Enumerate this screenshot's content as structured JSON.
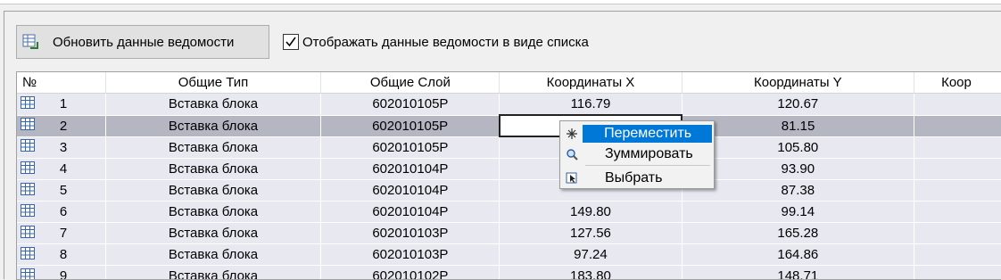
{
  "toolbar": {
    "update_label": "Обновить данные ведомости",
    "list_view_label": "Отображать данные ведомости в виде списка",
    "list_view_checked": true
  },
  "table": {
    "columns": [
      "№",
      "Общие Тип",
      "Общие Слой",
      "Координаты X",
      "Координаты Y",
      "Коор"
    ],
    "rows": [
      {
        "n": "1",
        "type": "Вставка блока",
        "layer": "602010105P",
        "x": "116.79",
        "y": "120.67"
      },
      {
        "n": "2",
        "type": "Вставка блока",
        "layer": "602010105P",
        "x": "",
        "y": "81.15"
      },
      {
        "n": "3",
        "type": "Вставка блока",
        "layer": "602010105P",
        "x": "",
        "y": "105.80"
      },
      {
        "n": "4",
        "type": "Вставка блока",
        "layer": "602010104P",
        "x": "",
        "y": "93.90"
      },
      {
        "n": "5",
        "type": "Вставка блока",
        "layer": "602010104P",
        "x": "",
        "y": "87.38"
      },
      {
        "n": "6",
        "type": "Вставка блока",
        "layer": "602010104P",
        "x": "149.80",
        "y": "99.14"
      },
      {
        "n": "7",
        "type": "Вставка блока",
        "layer": "602010103P",
        "x": "127.56",
        "y": "165.28"
      },
      {
        "n": "8",
        "type": "Вставка блока",
        "layer": "602010103P",
        "x": "97.24",
        "y": "164.86"
      },
      {
        "n": "9",
        "type": "Вставка блока",
        "layer": "602010102P",
        "x": "183.80",
        "y": "148.71"
      }
    ]
  },
  "context_menu": {
    "items": [
      {
        "label": "Переместить",
        "icon": "move-icon"
      },
      {
        "label": "Зуммировать",
        "icon": "zoom-icon"
      },
      {
        "label": "Выбрать",
        "icon": "select-icon"
      }
    ]
  },
  "colors": {
    "row_bg": "#e7e8f0",
    "selected_row_bg": "#b4b6c2",
    "menu_highlight": "#0078d7"
  }
}
